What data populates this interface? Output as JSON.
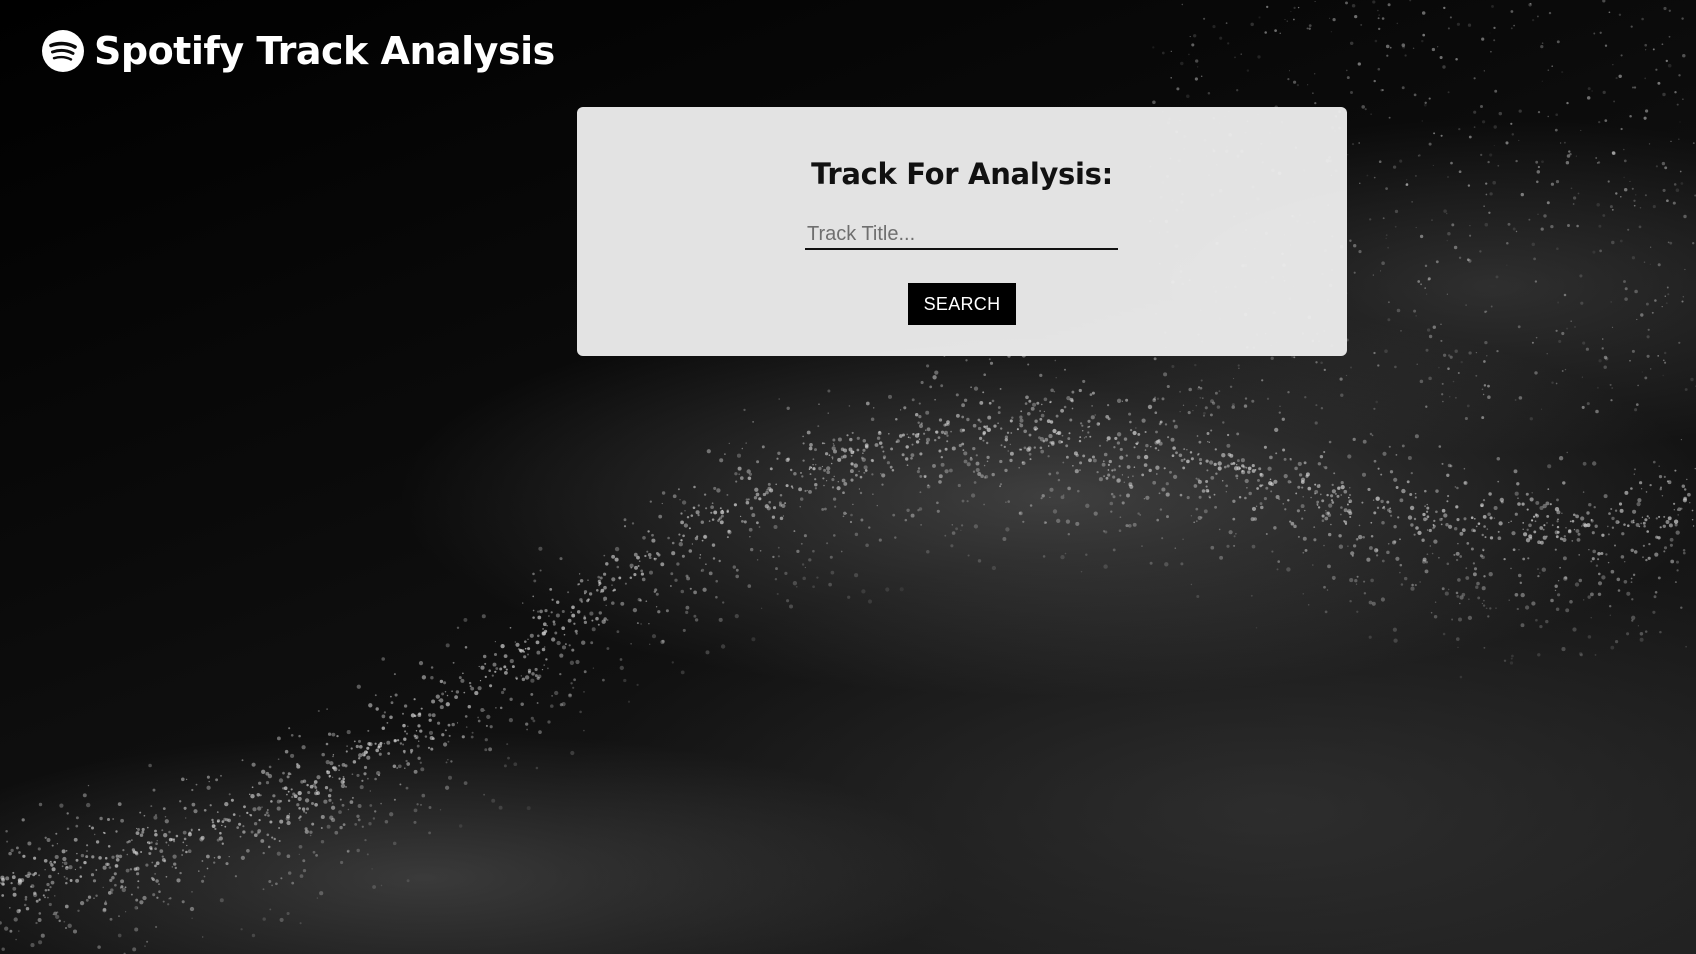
{
  "header": {
    "title": "Spotify Track Analysis",
    "logo_icon": "spotify-logo-icon"
  },
  "search_card": {
    "heading": "Track For Analysis:",
    "input": {
      "value": "",
      "placeholder": "Track Title..."
    },
    "button_label": "SEARCH"
  },
  "colors": {
    "background": "#050505",
    "card": "#ececec",
    "button": "#000000",
    "button_text": "#ffffff",
    "title_text": "#ffffff"
  }
}
